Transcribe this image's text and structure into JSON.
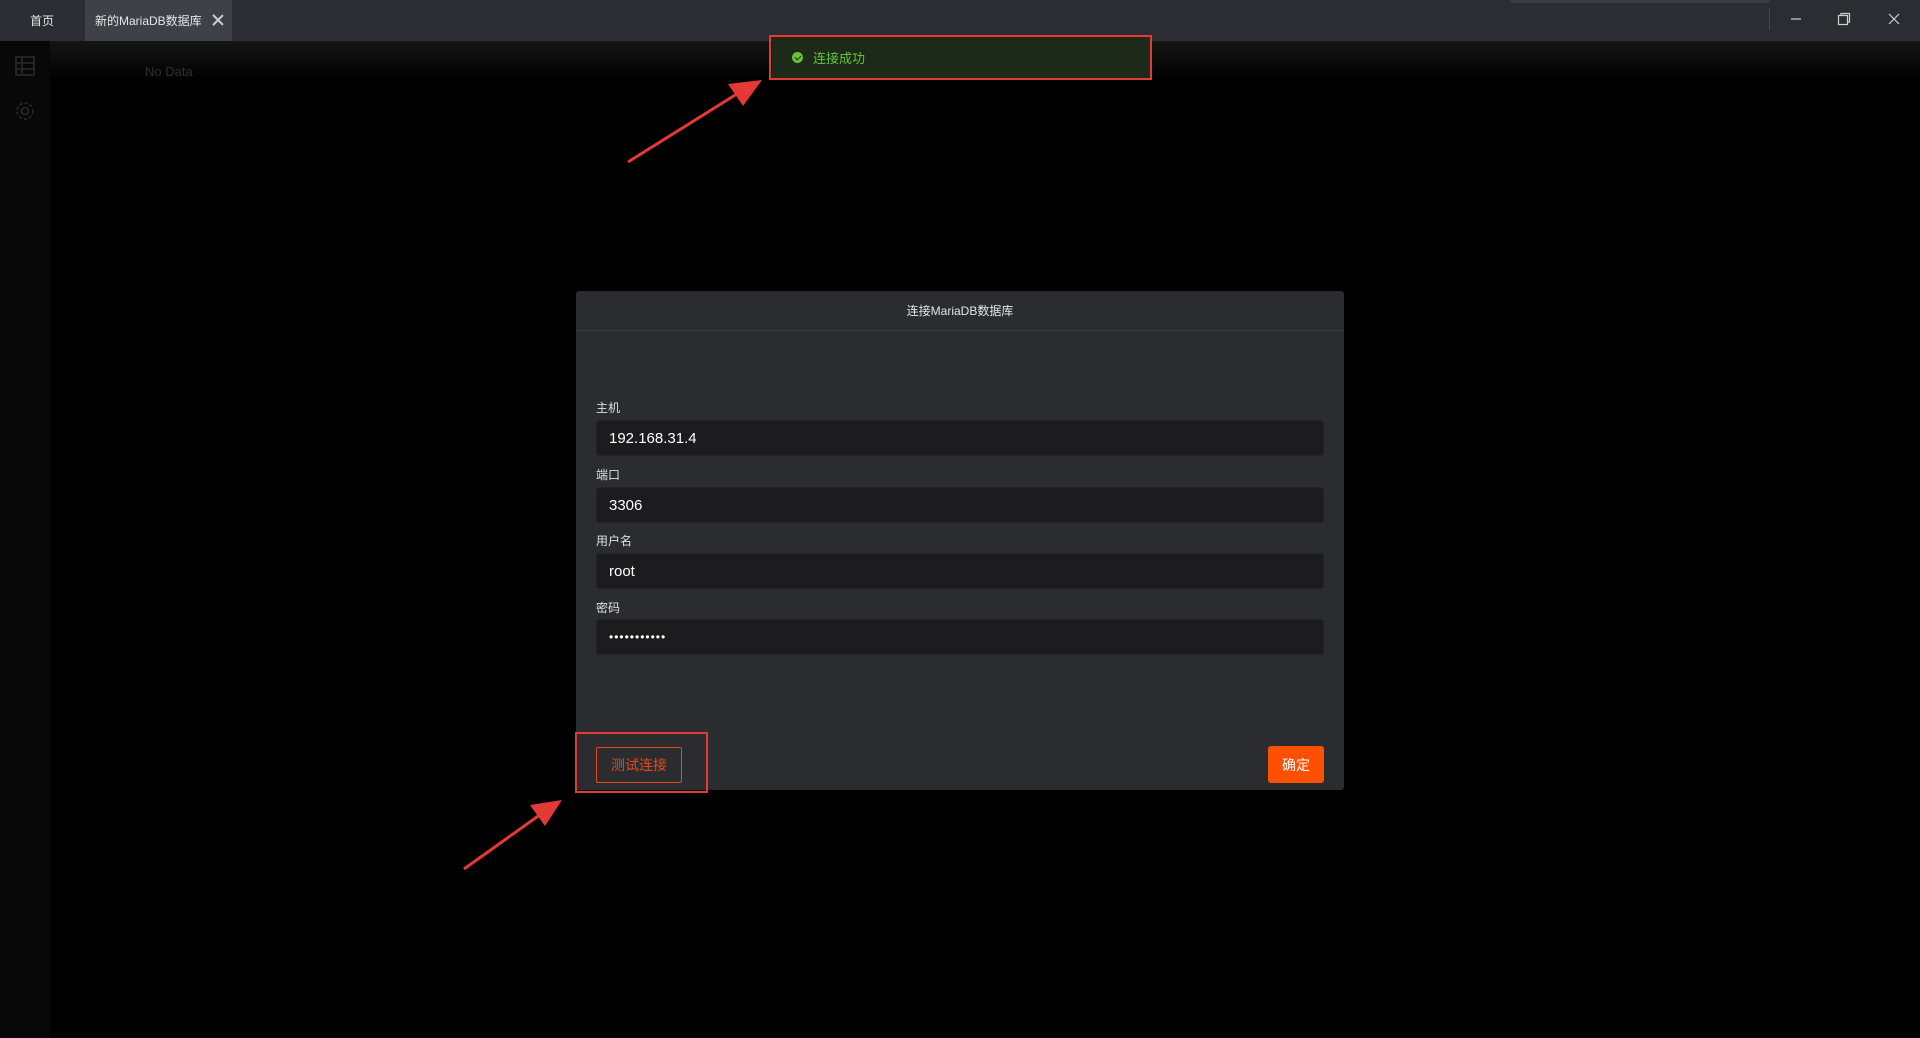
{
  "titlebar": {
    "home_tab": "首页",
    "active_tab": "新的MariaDB数据库"
  },
  "content": {
    "empty_text": "No Data"
  },
  "toast": {
    "message": "连接成功",
    "color": "#67c23a"
  },
  "dialog": {
    "title": "连接MariaDB数据库",
    "fields": [
      {
        "label": "主机",
        "value": "192.168.31.4"
      },
      {
        "label": "端口",
        "value": "3306"
      },
      {
        "label": "用户名",
        "value": "root"
      },
      {
        "label": "密码",
        "value": "•••••••••••"
      }
    ],
    "test_button": "测试连接",
    "ok_button": "确定"
  },
  "colors": {
    "accent": "#ff4f00",
    "annotation": "#e53935"
  }
}
